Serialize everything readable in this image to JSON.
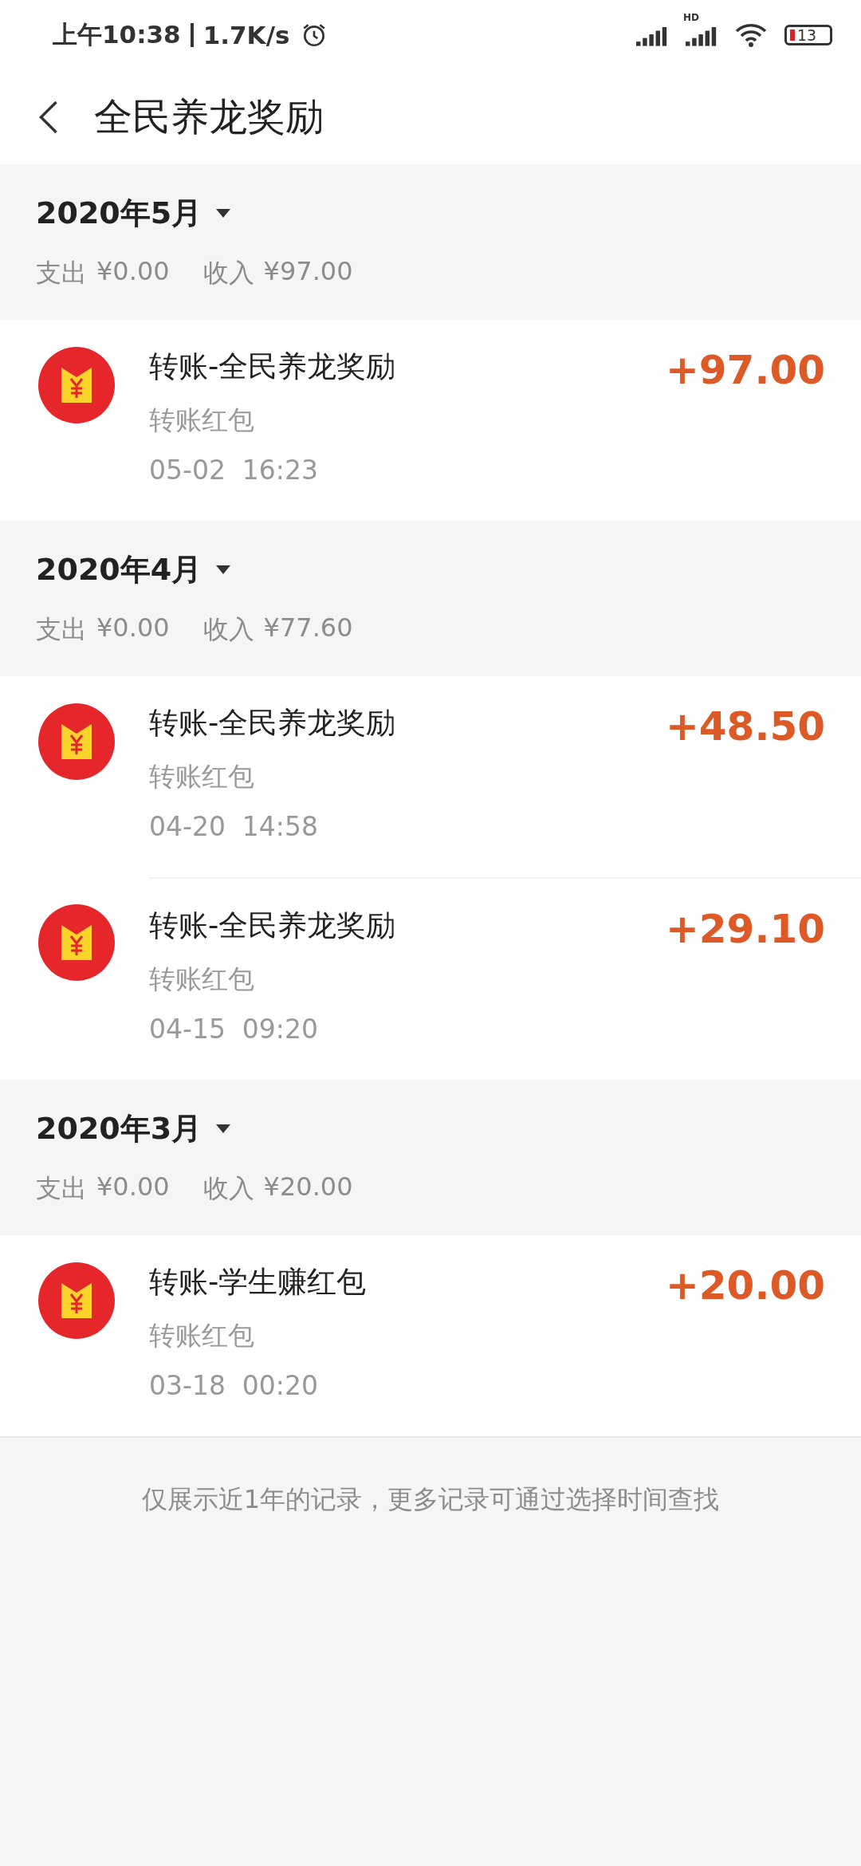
{
  "status_bar": {
    "time": "上午10:38",
    "speed": "1.7K/s",
    "network_label": "HD",
    "battery": "13"
  },
  "header": {
    "title": "全民养龙奖励"
  },
  "months": [
    {
      "title": "2020年5月",
      "expense_label": "支出",
      "expense": "¥0.00",
      "income_label": "收入",
      "income": "¥97.00",
      "records": [
        {
          "title": "转账-全民养龙奖励",
          "subtitle": "转账红包",
          "date": "05-02",
          "time": "16:23",
          "amount": "+97.00"
        }
      ]
    },
    {
      "title": "2020年4月",
      "expense_label": "支出",
      "expense": "¥0.00",
      "income_label": "收入",
      "income": "¥77.60",
      "records": [
        {
          "title": "转账-全民养龙奖励",
          "subtitle": "转账红包",
          "date": "04-20",
          "time": "14:58",
          "amount": "+48.50"
        },
        {
          "title": "转账-全民养龙奖励",
          "subtitle": "转账红包",
          "date": "04-15",
          "time": "09:20",
          "amount": "+29.10"
        }
      ]
    },
    {
      "title": "2020年3月",
      "expense_label": "支出",
      "expense": "¥0.00",
      "income_label": "收入",
      "income": "¥20.00",
      "records": [
        {
          "title": "转账-学生赚红包",
          "subtitle": "转账红包",
          "date": "03-18",
          "time": "00:20",
          "amount": "+20.00"
        }
      ]
    }
  ],
  "footer_note": "仅展示近1年的记录，更多记录可通过选择时间查找"
}
